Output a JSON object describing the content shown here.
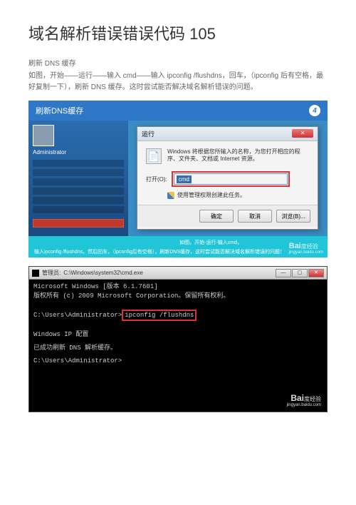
{
  "title": "域名解析错误错误代码 105",
  "subtitle": "刷新 DNS 缓存",
  "body": "如图，开始——运行——输入 cmd——输入 ipconfig  /flushdns，回车，（ipconfig 后有空格，最好复制一下），刷新 DNS 缓存。这时尝试能否解决域名解析错误的问题。",
  "screenshot1": {
    "banner": "刷新DNS缓存",
    "step_num": "4",
    "admin": "Administrator",
    "run_title": "运行",
    "run_desc": "Windows 将根据您所输入的名称，为您打开相应的程序、文件夹、文档或 Internet 资源。",
    "open_label": "打开(O):",
    "input_value": "cmd",
    "admin_priv": "使用管理权限创建此任务。",
    "btn_ok": "确定",
    "btn_cancel": "取消",
    "btn_browse": "浏览(B)...",
    "instruction_top": "如图，开始-运行-输入cmd，",
    "caption": "输入ipconfig /flushdns，然后回车，（ipconfig后有空格），刷新DNS缓存，这时尝试能否解决域名解析错误的问题！",
    "watermark_brand": "Bai",
    "watermark_suffix": "经验",
    "watermark_url": "jingyan.baidu.com"
  },
  "screenshot2": {
    "title_prefix": "管理员:",
    "title_path": "C:\\Windows\\system32\\cmd.exe",
    "line1": "Microsoft Windows [版本 6.1.7601]",
    "line2": "版权所有 (c) 2009 Microsoft Corporation。保留所有权利。",
    "prompt1": "C:\\Users\\Administrator>",
    "command": "ipconfig /flushdns",
    "config_header": "Windows IP 配置",
    "success": "已成功刷新 DNS 解析缓存。",
    "prompt2": "C:\\Users\\Administrator>",
    "watermark_brand": "Bai",
    "watermark_suffix": "经验",
    "watermark_url": "jingyan.baidu.com"
  }
}
